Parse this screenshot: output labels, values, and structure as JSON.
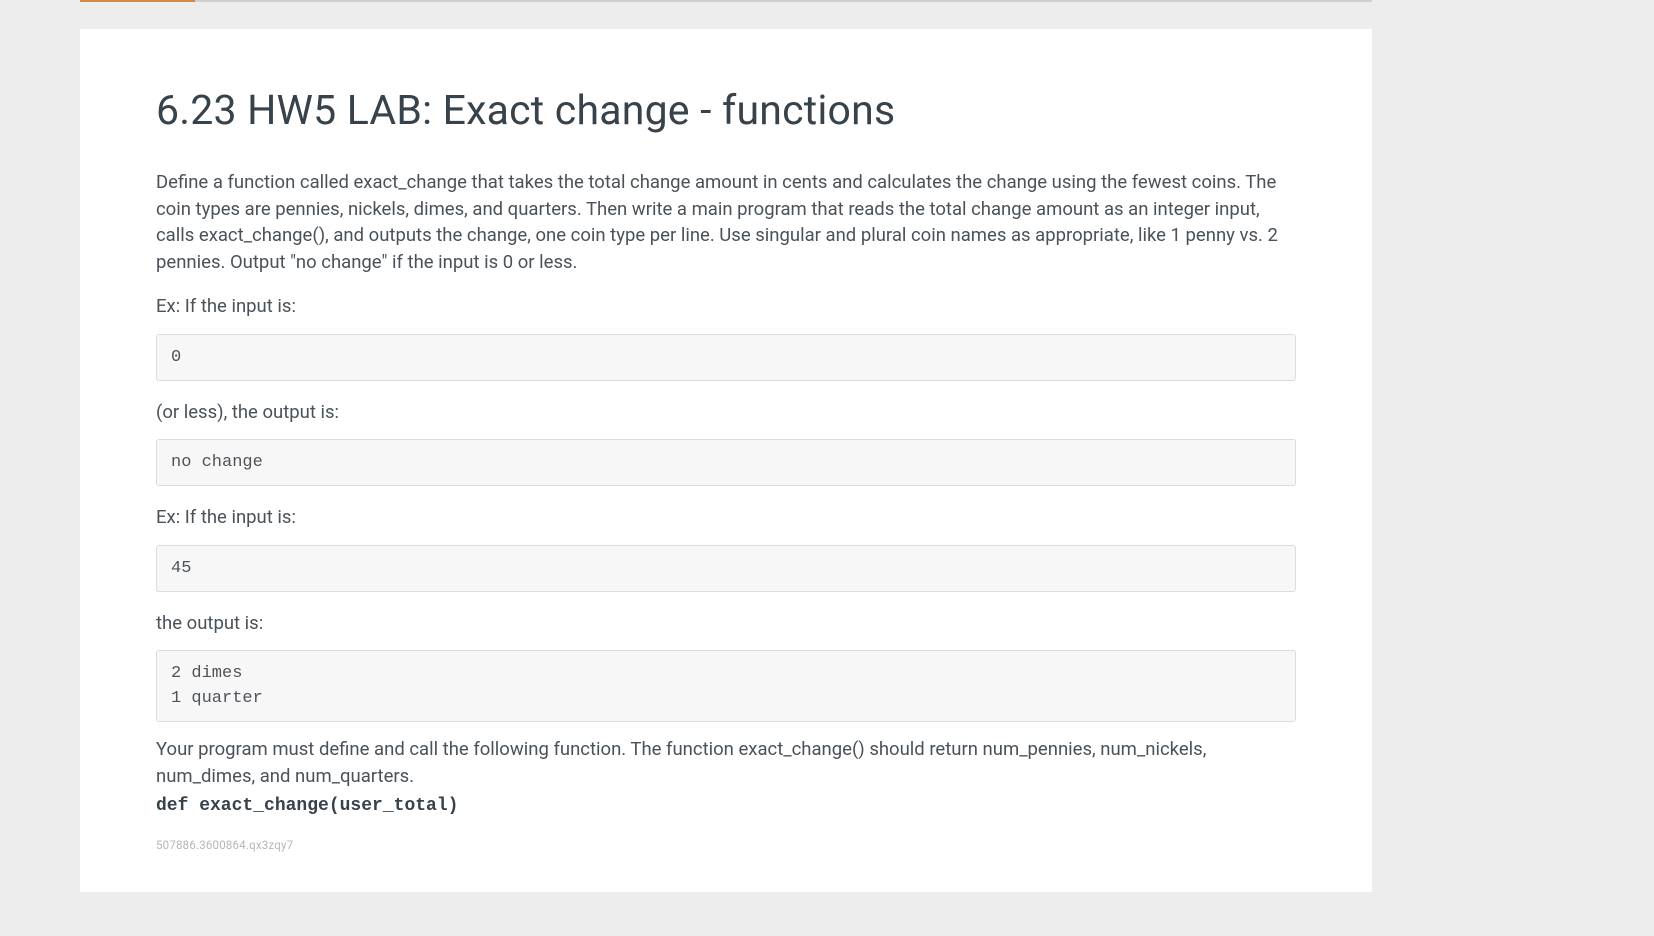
{
  "title": "6.23 HW5 LAB: Exact change - functions",
  "intro": "Define a function called exact_change that takes the total change amount in cents and calculates the change using the fewest coins. The coin types are pennies, nickels, dimes, and quarters. Then write a main program that reads the total change amount as an integer input, calls exact_change(), and outputs the change, one coin type per line. Use singular and plural coin names as appropriate, like 1 penny vs. 2 pennies. Output \"no change\" if the input is 0 or less.",
  "ex1_label": "Ex: If the input is:",
  "ex1_input": "0",
  "ex1_mid": "(or less), the output is:",
  "ex1_output": "no change",
  "ex2_label": "Ex: If the input is:",
  "ex2_input": "45",
  "ex2_mid": "the output is:",
  "ex2_output": "2 dimes\n1 quarter",
  "closing": "Your program must define and call the following function. The function exact_change() should return num_pennies, num_nickels, num_dimes, and num_quarters.",
  "signature": "def exact_change(user_total)",
  "footer_code": "507886.3600864.qx3zqy7"
}
